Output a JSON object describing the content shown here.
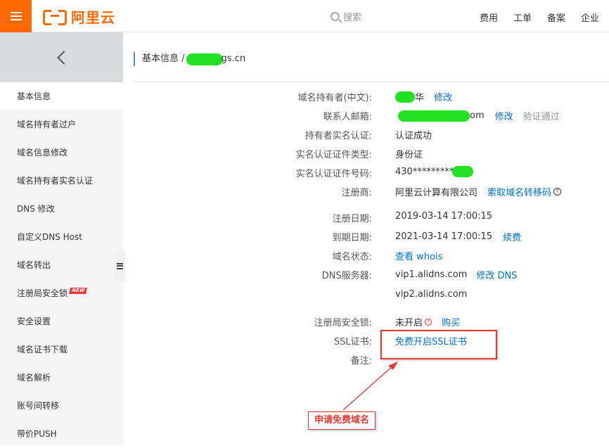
{
  "header": {
    "logo_text": "阿里云",
    "search_placeholder": "搜索",
    "nav": [
      "费用",
      "工单",
      "备案",
      "企业"
    ]
  },
  "sidebar": {
    "items": [
      {
        "label": "基本信息",
        "active": true
      },
      {
        "label": "域名持有者过户"
      },
      {
        "label": "域名信息修改"
      },
      {
        "label": "域名持有者实名认证"
      },
      {
        "label": "DNS 修改"
      },
      {
        "label": "自定义DNS Host"
      },
      {
        "label": "域名转出"
      },
      {
        "label": "注册局安全锁",
        "badge": "NEW"
      },
      {
        "label": "安全设置"
      },
      {
        "label": "域名证书下载"
      },
      {
        "label": "域名解析"
      },
      {
        "label": "账号间转移"
      },
      {
        "label": "带价PUSH"
      }
    ]
  },
  "breadcrumb": {
    "prefix": "基本信息 /",
    "suffix": "gs.cn"
  },
  "info": {
    "owner_label": "域名持有者(中文):",
    "owner_suffix": "华",
    "owner_action": "修改",
    "email_label": "联系人邮箱:",
    "email_suffix": "om",
    "email_action": "修改",
    "email_status": "验证通过",
    "realname_label": "持有者实名认证:",
    "realname_value": "认证成功",
    "idtype_label": "实名认证证件类型:",
    "idtype_value": "身份证",
    "idno_label": "实名认证证件号码:",
    "idno_value": "430*********",
    "registrar_label": "注册商:",
    "registrar_value": "阿里云计算有限公司",
    "registrar_action": "索取域名转移码",
    "regdate_label": "注册日期:",
    "regdate_value": "2019-03-14 17:00:15",
    "expdate_label": "到期日期:",
    "expdate_value": "2021-03-14 17:00:15",
    "expdate_action": "续费",
    "status_label": "域名状态:",
    "status_action": "查看 whois",
    "dns_label": "DNS服务器:",
    "dns1": "vip1.alidns.com",
    "dns_action": "修改 DNS",
    "dns2": "vip2.alidns.com",
    "lock_label": "注册局安全锁:",
    "lock_value": "未开启",
    "lock_action": "购买",
    "ssl_label": "SSL证书:",
    "ssl_action": "免费开启SSL证书",
    "note_label": "备注:"
  },
  "annotation": {
    "text": "申请免费域名",
    "color": "#e53935"
  },
  "colors": {
    "brand": "#ff6a00",
    "link": "#0070cc"
  }
}
